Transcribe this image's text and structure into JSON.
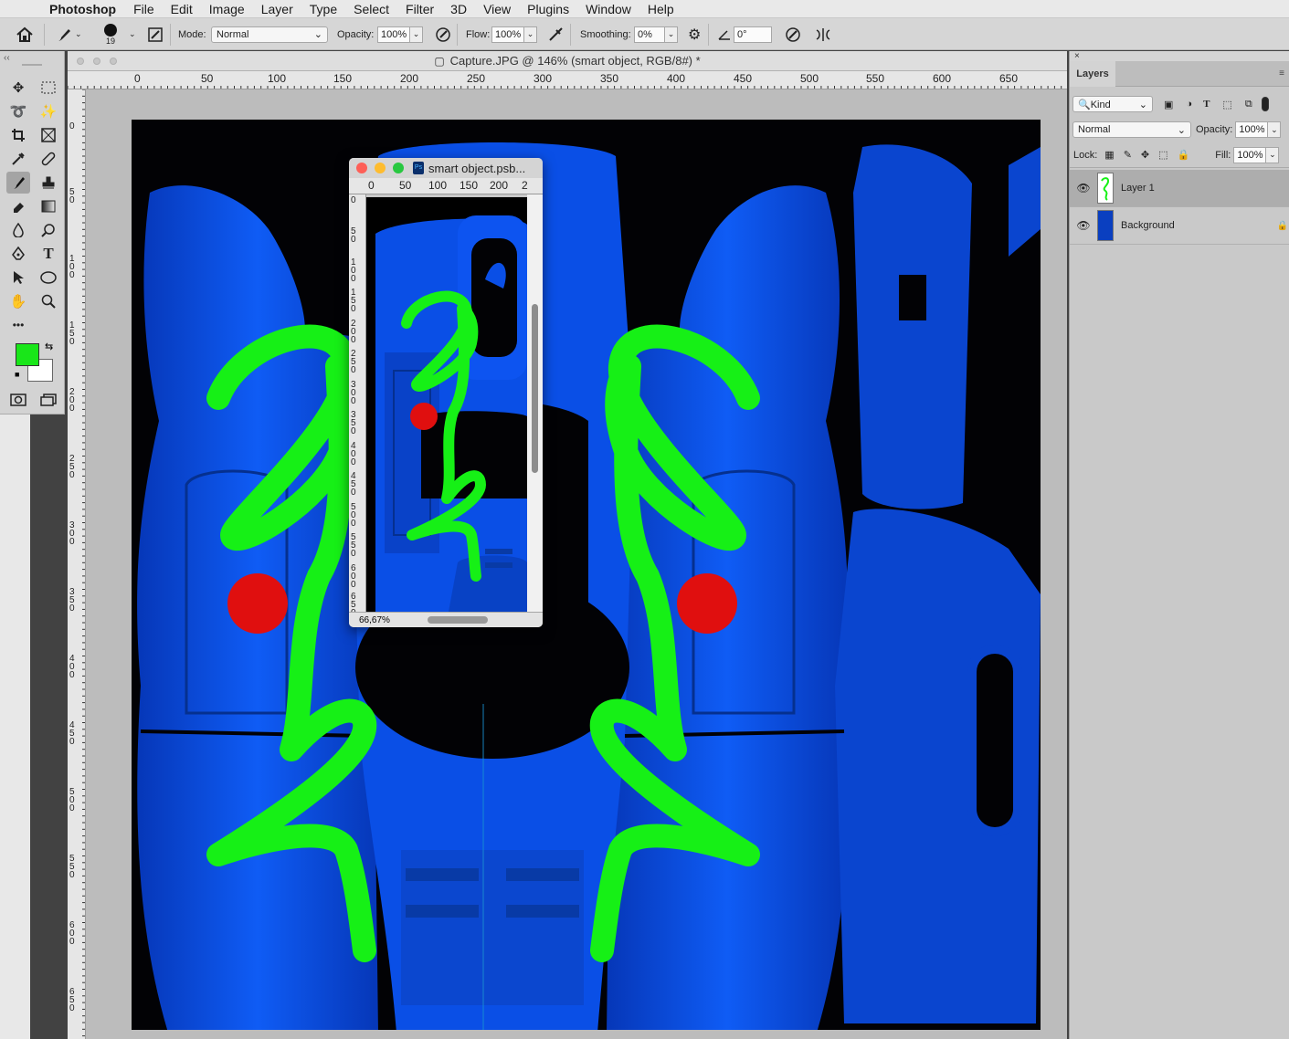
{
  "menubar": {
    "app_name": "Photoshop",
    "items": [
      "File",
      "Edit",
      "Image",
      "Layer",
      "Type",
      "Select",
      "Filter",
      "3D",
      "View",
      "Plugins",
      "Window",
      "Help"
    ]
  },
  "options": {
    "brush_size": "19",
    "mode_label": "Mode:",
    "mode_value": "Normal",
    "opacity_label": "Opacity:",
    "opacity_value": "100%",
    "flow_label": "Flow:",
    "flow_value": "100%",
    "smoothing_label": "Smoothing:",
    "smoothing_value": "0%",
    "angle_value": "0°"
  },
  "toolbar": {
    "foreground_color": "#19e619",
    "background_color": "#ffffff",
    "more_label": "•••"
  },
  "document": {
    "title": "Capture.JPG @ 146% (smart object, RGB/8#) *",
    "h_ruler": [
      "0",
      "50",
      "100",
      "150",
      "200",
      "250",
      "300",
      "350",
      "400",
      "450",
      "500",
      "550",
      "600",
      "650"
    ],
    "v_ruler": [
      "0",
      "50",
      "100",
      "150",
      "200",
      "250",
      "300",
      "350",
      "400",
      "450",
      "500",
      "550",
      "600",
      "650"
    ]
  },
  "smart_object": {
    "title": "smart object.psb...",
    "h_ruler": [
      "0",
      "50",
      "100",
      "150",
      "200",
      "2"
    ],
    "v_ruler": [
      "0",
      "50",
      "100",
      "150",
      "200",
      "250",
      "300",
      "350",
      "400",
      "450",
      "500",
      "550",
      "600",
      "650"
    ],
    "zoom": "66,67%"
  },
  "layers_panel": {
    "close_glyph": "×",
    "tab_label": "Layers",
    "filter_label": "Kind",
    "blend_mode": "Normal",
    "opacity_label": "Opacity:",
    "opacity_value": "100%",
    "lock_label": "Lock:",
    "fill_label": "Fill:",
    "fill_value": "100%",
    "layers": [
      {
        "name": "Layer 1",
        "selected": true
      },
      {
        "name": "Background",
        "locked": true
      }
    ]
  },
  "colors": {
    "paint_blue": "#0a52f0",
    "stroke_green": "#16f016",
    "dot_red": "#e00f0f"
  }
}
